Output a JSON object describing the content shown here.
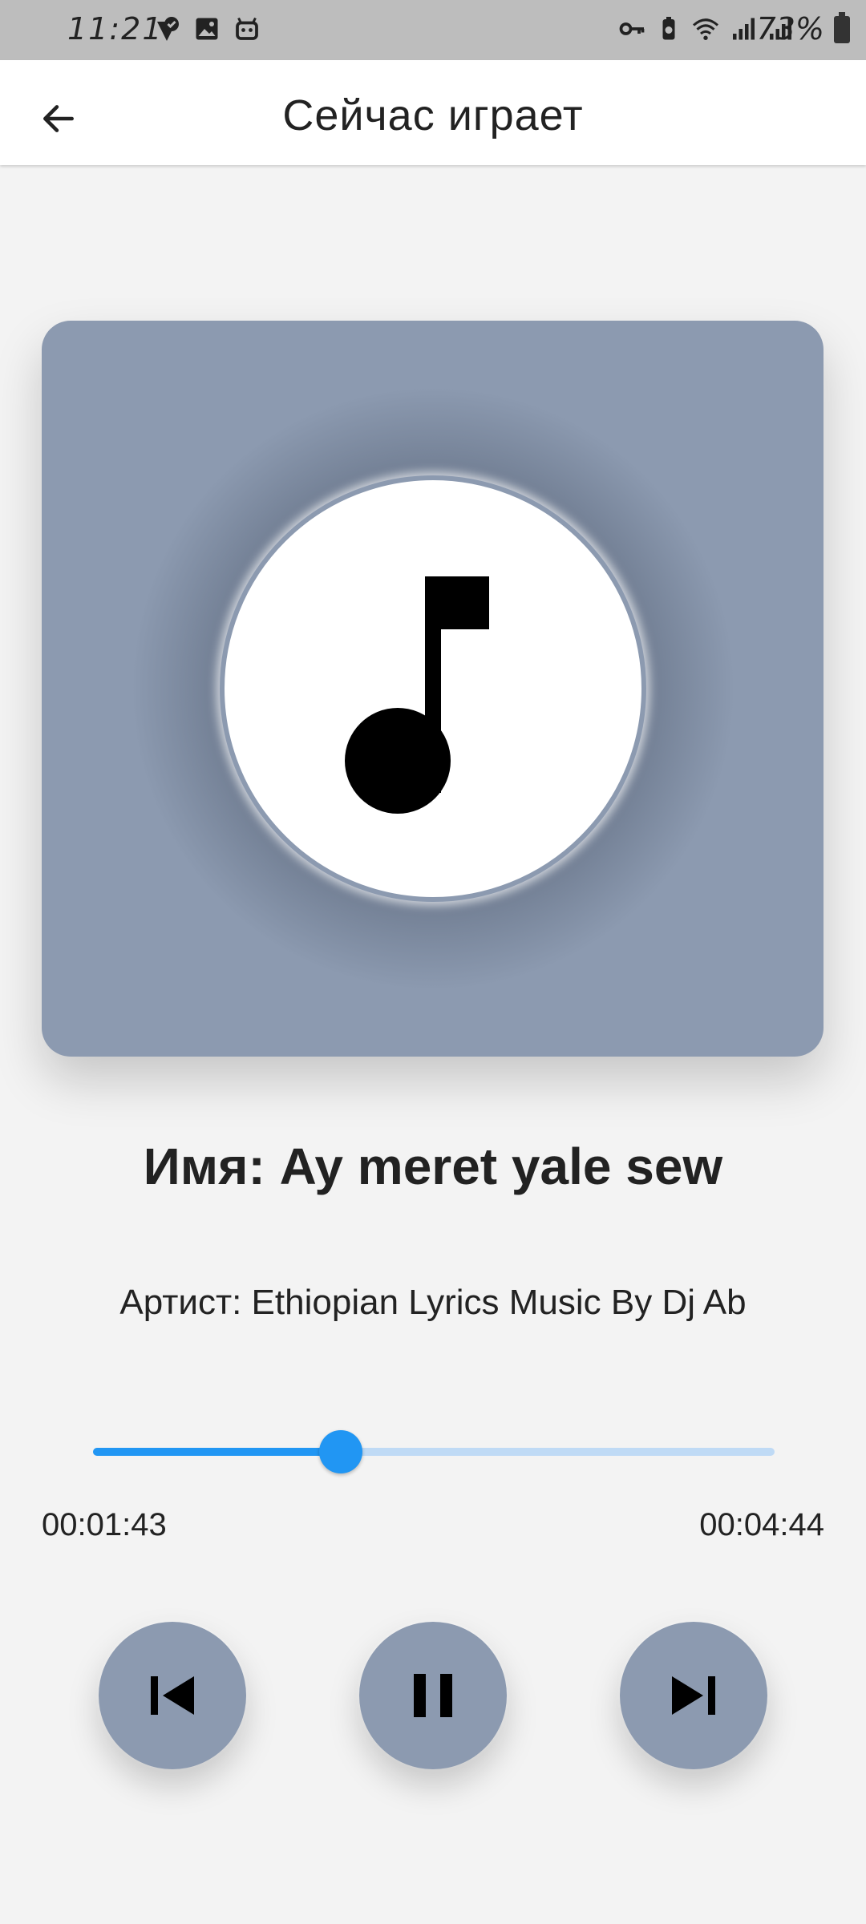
{
  "status_bar": {
    "time": "11:21",
    "battery_percent": "73%",
    "left_icons": [
      "check-pin-icon",
      "image-icon",
      "android-icon"
    ],
    "right_icons": [
      "key-icon",
      "battery-saver-icon",
      "wifi-icon",
      "signal-icon",
      "signal-icon"
    ]
  },
  "appbar": {
    "title": "Сейчас играет",
    "back_icon": "arrow-left-icon"
  },
  "album_art": {
    "icon": "music-note-icon",
    "background_color": "#8c9ab0"
  },
  "track": {
    "name": "Имя: Ay meret yale sew",
    "artist": "Артист: Ethiopian Lyrics Music By Dj Ab"
  },
  "progress": {
    "current_time": "00:01:43",
    "total_time": "00:04:44",
    "fraction": 0.363,
    "fill_color": "#2196f3",
    "track_color": "#bfdaf5"
  },
  "controls": {
    "prev_icon": "skip-previous-icon",
    "play_icon": "pause-icon",
    "next_icon": "skip-next-icon",
    "button_color": "#8c9ab0"
  }
}
